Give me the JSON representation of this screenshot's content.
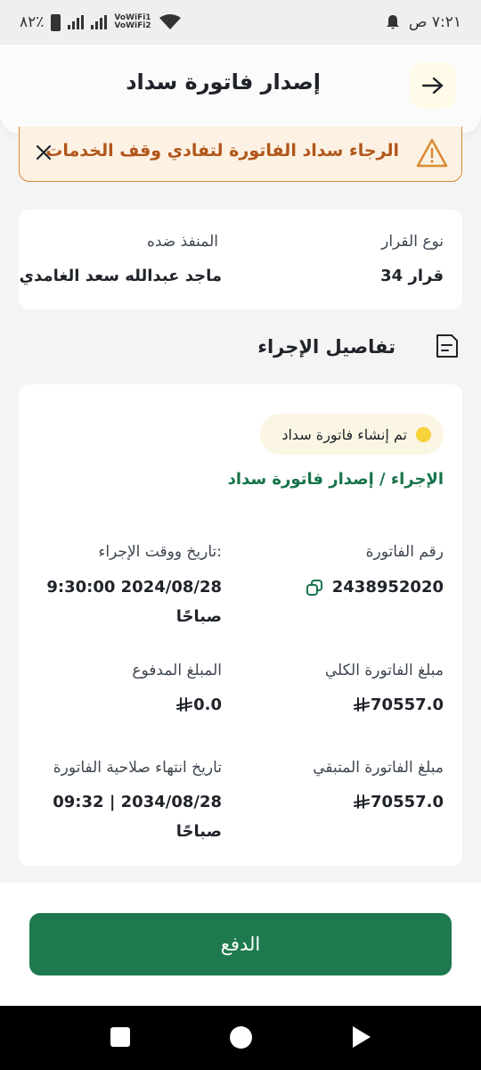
{
  "status_bar": {
    "time": "٧:٢١ ص",
    "battery": "٨٢٪",
    "vowifi1": "VoWiFi1",
    "vowifi2": "VoWiFi2"
  },
  "header": {
    "title": "إصدار فاتورة سداد",
    "back_icon": "arrow-right-icon"
  },
  "alert": {
    "message": "الرجاء سداد الفاتورة لتفادي وقف الخدمات",
    "warning_icon": "warning-triangle-icon",
    "close_icon": "close-icon"
  },
  "decision": {
    "type_label": "نوع القرار",
    "type_value": "قرار 34",
    "executed_against_label": "المنفذ ضده",
    "executed_against_value": "ماجد عبدالله سعد الغامدي"
  },
  "procedure": {
    "section_title": "تفاصيل الإجراء",
    "section_icon": "document-icon",
    "status_chip": "تم إنشاء فاتورة سداد",
    "status_color": "#f7d23a",
    "action_title": "الإجراء / إصدار فاتورة سداد",
    "invoice_number_label": "رقم الفاتورة",
    "invoice_number_value": "2438952020",
    "copy_icon": "copy-icon",
    "datetime_label": "تاريخ ووقت الإجراء:",
    "datetime_value_line1": "9:30:00 2024/08/28",
    "datetime_value_line2": "صباحًا",
    "total_label": "مبلغ الفاتورة الكلي",
    "total_value": "70557.0",
    "paid_label": "المبلغ المدفوع",
    "paid_value": "0.0",
    "remaining_label": "مبلغ الفاتورة المتبقي",
    "remaining_value": "70557.0",
    "expiry_label": "تاريخ انتهاء صلاحية الفاتورة",
    "expiry_value_line1": "09:32 | 2034/08/28",
    "expiry_value_line2": "صباحًا",
    "currency_icon": "riyal-icon"
  },
  "pay_button": {
    "label": "الدفع",
    "color": "#1e7a4e"
  },
  "colors": {
    "accent_green": "#17734a",
    "warning_text": "#b1561a",
    "warning_border": "#d98a32"
  }
}
